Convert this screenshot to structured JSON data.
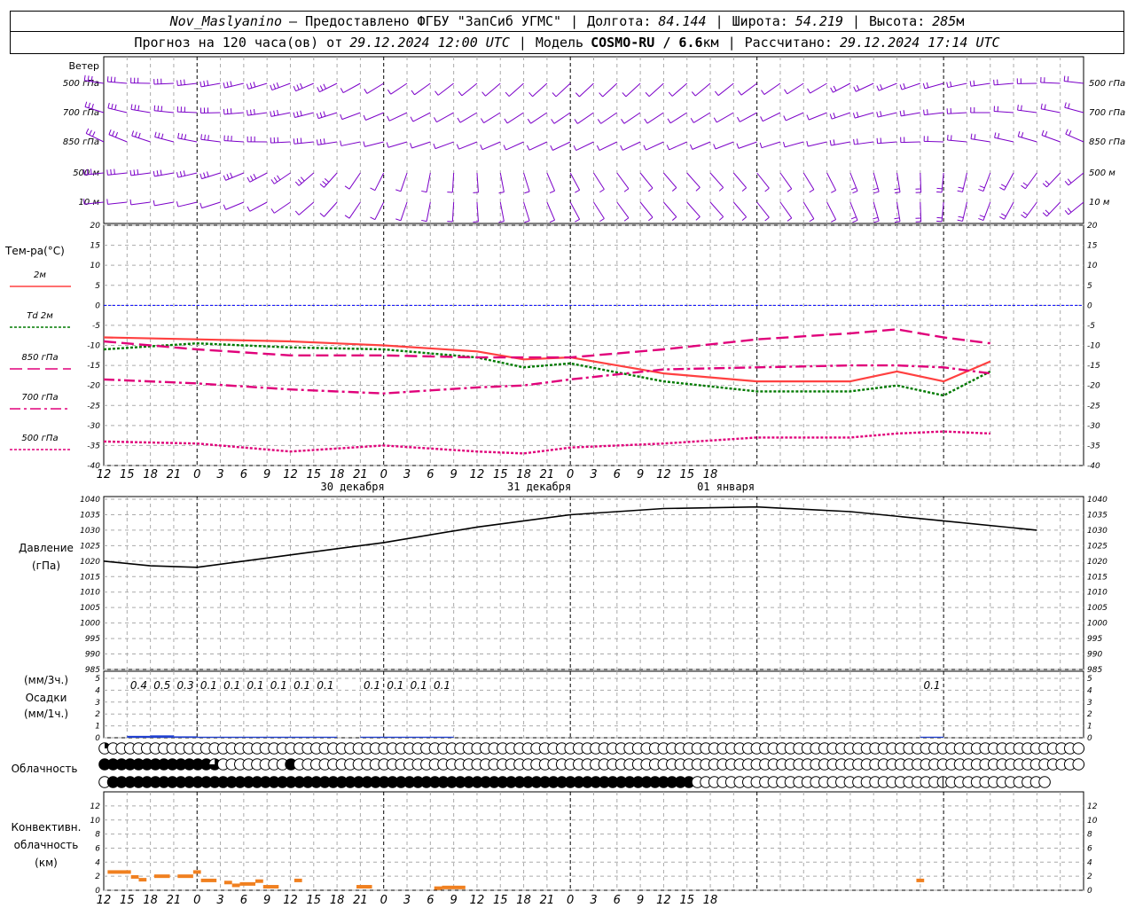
{
  "header": {
    "station": "Nov_Maslyanino",
    "provided_by": "— Предоставлено ФГБУ \"ЗапСиб УГМС\"",
    "lon_label": "Долгота:",
    "lon_value": "84.144",
    "lat_label": "Широта:",
    "lat_value": "54.219",
    "alt_label": "Высота:",
    "alt_value": "285",
    "alt_unit": "м",
    "forecast_label": "Прогноз на 120 часа(ов) от",
    "forecast_start": "29.12.2024 12:00 UTC",
    "model_label": "Модель",
    "model_name": "COSMO-RU / 6.6",
    "model_unit": "км",
    "calc_label": "Рассчитано:",
    "calc_time": "29.12.2024 17:14 UTC"
  },
  "chart_data": [
    {
      "type": "barbs",
      "panel": "wind",
      "title": "Ветер",
      "levels": [
        "500 гПа",
        "700 гПа",
        "850 гПа",
        "500 м",
        "10  м"
      ],
      "color": "#7b00c8"
    },
    {
      "type": "line",
      "panel": "temperature",
      "ylabel": "Тем-ра(°C)",
      "ylim": [
        -40,
        20
      ],
      "yticks": [
        20,
        15,
        10,
        5,
        0,
        -5,
        -10,
        -15,
        -20,
        -25,
        -30,
        -35,
        -40
      ],
      "x_hours": [
        0,
        12,
        24,
        36,
        48,
        54,
        60,
        72,
        84,
        96,
        102,
        108,
        114
      ],
      "series": [
        {
          "name": "2м",
          "color": "#ff4040",
          "style": "solid",
          "values": [
            -8,
            -8.5,
            -9,
            -10,
            -11.5,
            -13.5,
            -13,
            -17,
            -19,
            -19,
            -16.5,
            -19,
            -14
          ]
        },
        {
          "name": "Td  2м",
          "color": "#007a00",
          "style": "dotted",
          "values": [
            -11,
            -9.5,
            -10.5,
            -11,
            -13,
            -15.5,
            -14.5,
            -19,
            -21.5,
            -21.5,
            -20,
            -22.5,
            -16.5
          ]
        },
        {
          "name": "850 гПа",
          "color": "#e0007a",
          "style": "dashed",
          "values": [
            -9,
            -11,
            -12.5,
            -12.5,
            -13,
            -13,
            -13,
            -11,
            -8.5,
            -7,
            -6,
            -8,
            -9.5
          ]
        },
        {
          "name": "700 гПа",
          "color": "#e0007a",
          "style": "dashdot",
          "values": [
            -18.5,
            -19.5,
            -21,
            -22,
            -20.5,
            -20,
            -18.5,
            -16,
            -15.5,
            -15,
            -15,
            -15.5,
            -17
          ]
        },
        {
          "name": "500 гПа",
          "color": "#e0007a",
          "style": "dotted",
          "values": [
            -34,
            -34.5,
            -36.5,
            -35,
            -36.5,
            -37,
            -35.5,
            -34.5,
            -33,
            -33,
            -32,
            -31.5,
            -32
          ]
        }
      ],
      "zero_line_color": "#0000ff"
    },
    {
      "type": "line",
      "panel": "pressure",
      "ylabel": "Давление",
      "yunit": "(гПа)",
      "ylim": [
        985,
        1040
      ],
      "yticks": [
        1040,
        1035,
        1030,
        1025,
        1020,
        1015,
        1010,
        1005,
        1000,
        995,
        990,
        985
      ],
      "x_hours": [
        0,
        6,
        12,
        18,
        24,
        36,
        48,
        60,
        72,
        84,
        96,
        108,
        120
      ],
      "values": [
        1020,
        1018.5,
        1018,
        1020,
        1022,
        1026,
        1031,
        1035,
        1037,
        1037.5,
        1036,
        1033,
        1030
      ]
    },
    {
      "type": "bar",
      "panel": "precipitation",
      "ylabel_top": "(мм/3ч.)",
      "ylabel": "Осадки",
      "yunit": "(мм/1ч.)",
      "ylim": [
        0,
        5
      ],
      "yticks": [
        5,
        4,
        3,
        2,
        1,
        0
      ],
      "labels_3h": [
        {
          "hour": 3,
          "text": "0.4"
        },
        {
          "hour": 6,
          "text": "0.5"
        },
        {
          "hour": 9,
          "text": "0.3"
        },
        {
          "hour": 12,
          "text": "0.1"
        },
        {
          "hour": 15,
          "text": "0.1"
        },
        {
          "hour": 18,
          "text": "0.1"
        },
        {
          "hour": 21,
          "text": "0.1"
        },
        {
          "hour": 24,
          "text": "0.1"
        },
        {
          "hour": 27,
          "text": "0.1"
        },
        {
          "hour": 33,
          "text": "0.1"
        },
        {
          "hour": 36,
          "text": "0.1"
        },
        {
          "hour": 39,
          "text": "0.1"
        },
        {
          "hour": 42,
          "text": "0.1"
        },
        {
          "hour": 105,
          "text": "0.1"
        }
      ],
      "color": "#2040d0"
    },
    {
      "type": "table",
      "panel": "cloudiness",
      "ylabel": "Облачность",
      "rows": [
        "qooooooooooooooooooooooooooooooooooooooooooooooooooooooooooooooooooooooooooooooooooooooooooooooooooooooooooooooooooo",
        "fffffffffffffwoooooooofooooooooooooooooooooooooooooooooooooooooooooooooooooooooooooooooooooooooooooooooooooooooooooo",
        "offfffffffffffffffffffffffffffffffffffffffffffffffffffffffffffffffffffooooooooooooooooooooooooooooohoooooooooooo"
      ]
    },
    {
      "type": "bar",
      "panel": "convective",
      "ylabel": "Конвективн.",
      "ylabel2": "облачность",
      "yunit": "(км)",
      "ylim": [
        0,
        13
      ],
      "yticks": [
        12,
        10,
        8,
        6,
        4,
        2,
        0
      ],
      "color": "#f08020",
      "segments": [
        {
          "from": 0.5,
          "to": 3.5,
          "top": 2.6
        },
        {
          "from": 3.5,
          "to": 4.5,
          "top": 1.9
        },
        {
          "from": 4.5,
          "to": 5.5,
          "top": 1.5
        },
        {
          "from": 6.5,
          "to": 8.5,
          "top": 2.0
        },
        {
          "from": 9.5,
          "to": 11.5,
          "top": 2.0
        },
        {
          "from": 11.5,
          "to": 12.5,
          "top": 2.6
        },
        {
          "from": 12.5,
          "to": 14.5,
          "top": 1.4
        },
        {
          "from": 15.5,
          "to": 16.5,
          "top": 1.1
        },
        {
          "from": 16.5,
          "to": 17.5,
          "top": 0.7
        },
        {
          "from": 17.5,
          "to": 19.5,
          "top": 0.9
        },
        {
          "from": 19.5,
          "to": 20.5,
          "top": 1.3
        },
        {
          "from": 20.5,
          "to": 22.5,
          "top": 0.5
        },
        {
          "from": 24.5,
          "to": 25.5,
          "top": 1.4
        },
        {
          "from": 32.5,
          "to": 34.5,
          "top": 0.5
        },
        {
          "from": 42.5,
          "to": 43.5,
          "top": 0.3
        },
        {
          "from": 43.5,
          "to": 46.5,
          "top": 0.4
        },
        {
          "from": 104.5,
          "to": 105.5,
          "top": 1.4
        }
      ]
    }
  ],
  "time_axis": {
    "hour_labels": [
      "12",
      "15",
      "18",
      "21",
      "0",
      "3",
      "6",
      "9",
      "12",
      "15",
      "18",
      "21",
      "0",
      "3",
      "6",
      "9",
      "12",
      "15",
      "18",
      "21",
      "0",
      "3",
      "6",
      "9",
      "12",
      "15",
      "18"
    ],
    "dates": [
      {
        "hour": 24,
        "text": "30 декабря"
      },
      {
        "hour": 48,
        "text": "31 декабря"
      },
      {
        "hour": 72,
        "text": "01 января"
      }
    ]
  }
}
